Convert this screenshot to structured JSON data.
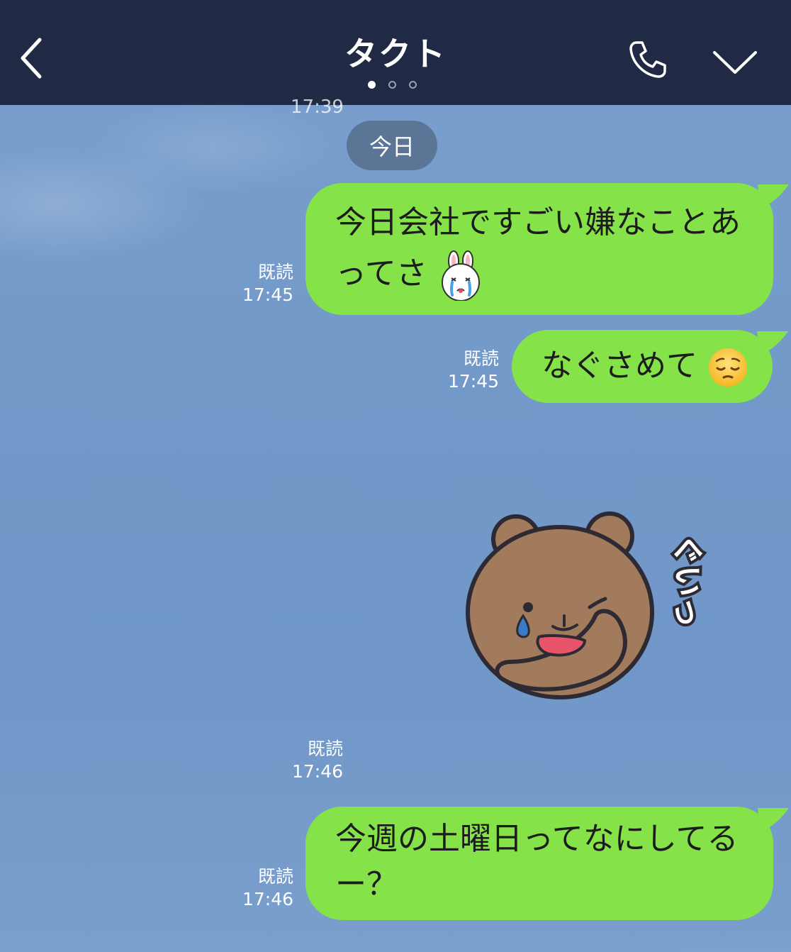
{
  "header": {
    "title": "タクト",
    "page_indicator": {
      "count": 3,
      "active_index": 0
    }
  },
  "chat": {
    "cut_off_time": "17:39",
    "date_separator": "今日",
    "messages": [
      {
        "type": "text",
        "line1": "今日会社ですごい嫌なことあ",
        "line2": "ってさ",
        "emoji": "crying-bunny-emoji",
        "read_label": "既読",
        "time": "17:45"
      },
      {
        "type": "text",
        "line1": "なぐさめて",
        "emoji": "pensive-face-emoji",
        "read_label": "既読",
        "time": "17:45"
      },
      {
        "type": "sticker",
        "sticker": "crying-bear-sticker",
        "sticker_text": "ぐいっ",
        "read_label": "既読",
        "time": "17:46"
      },
      {
        "type": "text",
        "line1": "今週の土曜日ってなにしてる",
        "line2": "ー？",
        "read_label": "既読",
        "time": "17:46"
      }
    ]
  },
  "colors": {
    "header_bg": "#212a44",
    "bubble_green": "#85e249",
    "background_sky": "#7399c9",
    "date_pill": "#5b7596"
  }
}
